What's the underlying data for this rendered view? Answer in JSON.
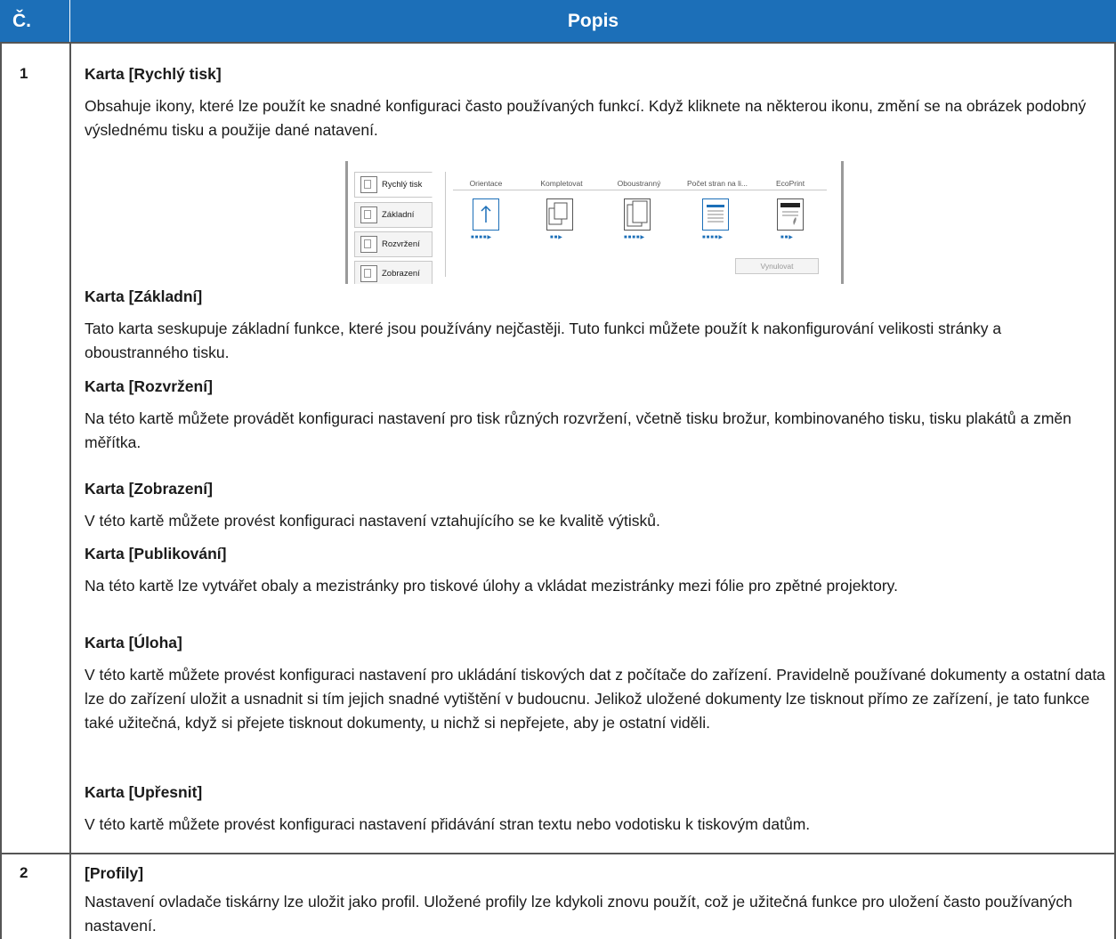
{
  "header": {
    "col_num": "Č.",
    "col_desc": "Popis"
  },
  "rows": [
    {
      "num": "1",
      "sections": [
        {
          "title": "Karta [Rychlý tisk]",
          "text": "Obsahuje ikony, které lze použít ke snadné konfiguraci často používaných funkcí. Když kliknete na některou ikonu, změní se na obrázek podobný výslednému tisku a použije dané natavení."
        },
        {
          "title": "Karta [Základní]",
          "text": "Tato karta seskupuje základní funkce, které jsou používány nejčastěji. Tuto funkci můžete použít k nakonfigurování velikosti stránky a oboustranného tisku."
        },
        {
          "title": "Karta [Rozvržení]",
          "text": "Na této kartě můžete provádět konfiguraci nastavení pro tisk různých rozvržení, včetně tisku brožur, kombinovaného tisku, tisku plakátů a změn měřítka."
        },
        {
          "title": "Karta [Zobrazení]",
          "text": "V této kartě můžete provést konfiguraci nastavení vztahujícího se ke kvalitě výtisků."
        },
        {
          "title": "Karta [Publikování]",
          "text": "Na této kartě lze vytvářet obaly a mezistránky pro tiskové úlohy a vkládat mezistránky mezi fólie pro zpětné projektory."
        },
        {
          "title": "Karta [Úloha]",
          "text": "V této kartě můžete provést konfiguraci nastavení pro ukládání tiskových dat z počítače do zařízení. Pravidelně používané dokumenty a ostatní data lze do zařízení uložit a usnadnit si tím jejich snadné vytištění v budoucnu. Jelikož uložené dokumenty lze tisknout přímo ze zařízení, je tato funkce také užitečná, když si přejete tisknout dokumenty, u nichž si nepřejete, aby je ostatní viděli."
        },
        {
          "title": "Karta [Upřesnit]",
          "text": "V této kartě můžete provést konfiguraci nastavení přidávání stran textu nebo vodotisku k tiskovým datům."
        }
      ]
    },
    {
      "num": "2",
      "sections": [
        {
          "title": "[Profily]",
          "text": "Nastavení ovladače tiskárny lze uložit jako profil. Uložené profily lze kdykoli znovu použít, což je užitečná funkce pro uložení často používaných nastavení."
        }
      ]
    }
  ],
  "screenshot": {
    "side_tabs": [
      "Rychlý tisk",
      "Základní",
      "Rozvržení",
      "Zobrazení"
    ],
    "columns": [
      "Orientace",
      "Kompletovat",
      "Oboustranný",
      "Počet stran na li...",
      "EcoPrint"
    ],
    "reset_button": "Vynulovat",
    "accent_color": "#1c6fb8"
  }
}
